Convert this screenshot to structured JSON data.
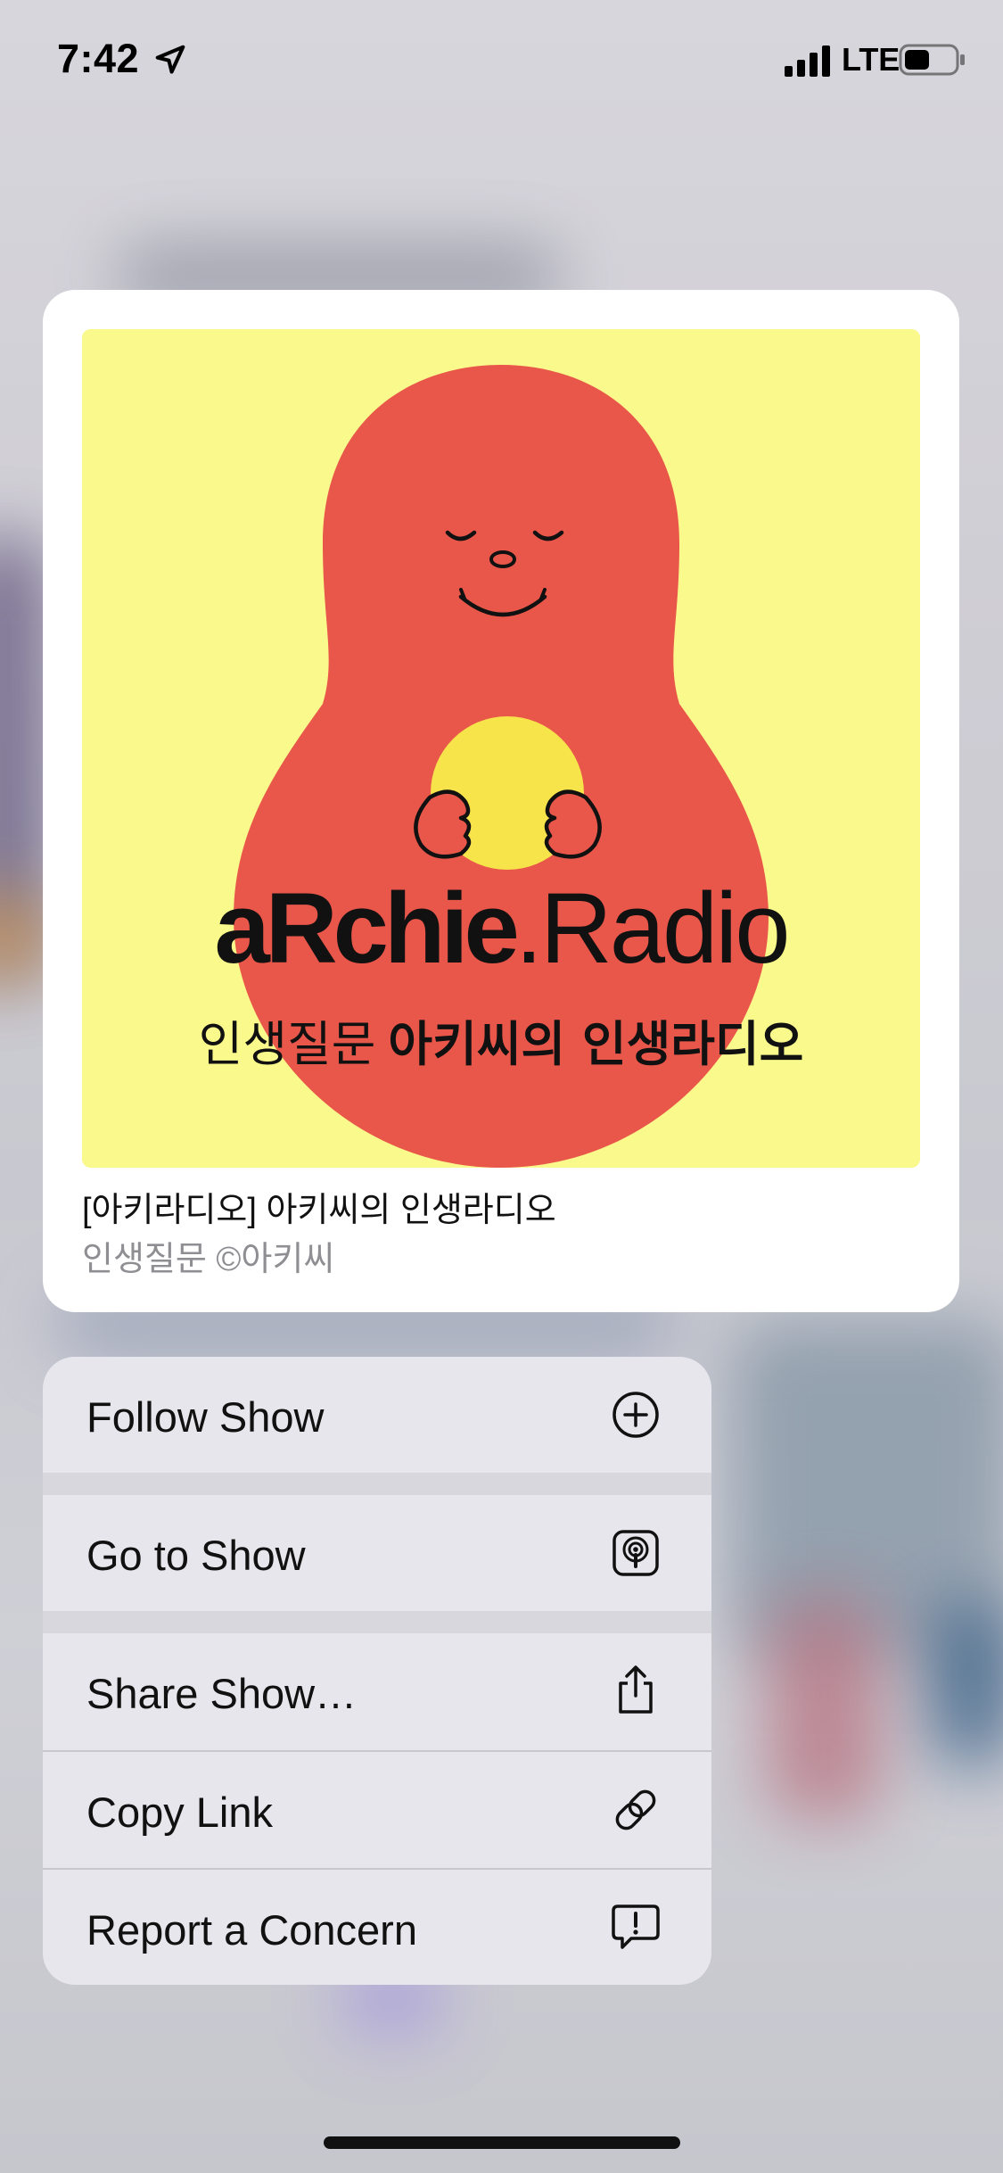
{
  "status_bar": {
    "time": "7:42",
    "network": "LTE",
    "icons": [
      "location-arrow-icon",
      "signal-bars-icon",
      "battery-icon"
    ]
  },
  "preview": {
    "artwork": {
      "brand_bold": "aRchie",
      "brand_light": ".Radio",
      "subtitle_light": "인생질문",
      "subtitle_bold": "아키씨의 인생라디오",
      "colors": {
        "background": "#fafa8c",
        "figure": "#e9564a",
        "heart": "#f7e34a",
        "ink": "#111111"
      }
    },
    "title": "[아키라디오] 아키씨의 인생라디오",
    "author": "인생질문 ©아키씨"
  },
  "menu": {
    "items": [
      {
        "label": "Follow Show",
        "icon": "plus-circle-icon"
      },
      {
        "label": "Go to Show",
        "icon": "podcasts-icon"
      },
      {
        "label": "Share Show…",
        "icon": "share-icon"
      },
      {
        "label": "Copy Link",
        "icon": "link-icon"
      },
      {
        "label": "Report a Concern",
        "icon": "exclamation-bubble-icon"
      }
    ]
  }
}
